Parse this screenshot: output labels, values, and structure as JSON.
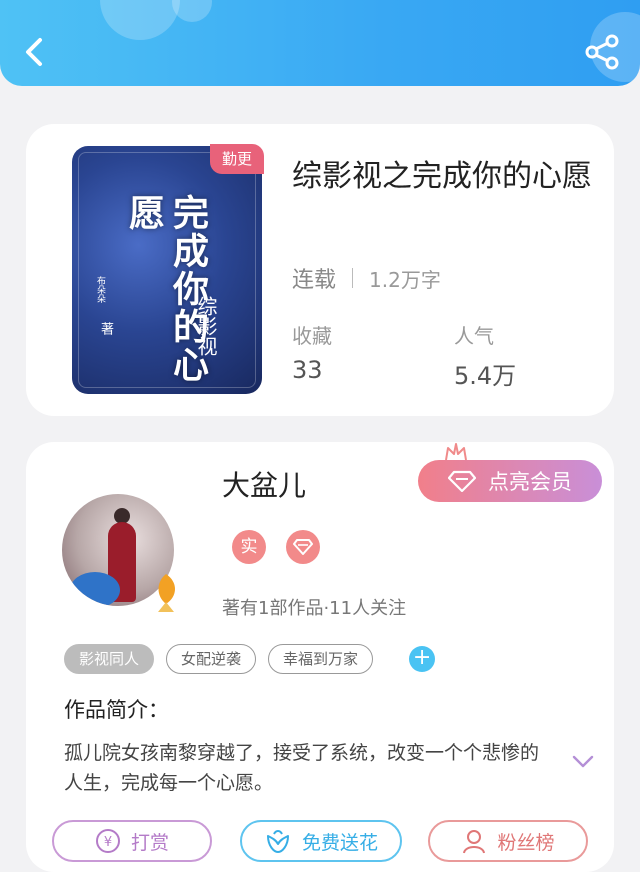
{
  "header": {
    "back_icon": "back-arrow-icon",
    "share_icon": "share-icon"
  },
  "book": {
    "badge": "勤更",
    "cover_title": "完成你的心愿",
    "cover_subtitle": "综影视",
    "cover_author": "布朵朵",
    "cover_author_mark": "著",
    "title": "综影视之完成你的心愿",
    "status": "连载",
    "word_count": "1.2万字",
    "stats": [
      {
        "label": "收藏",
        "value": "33"
      },
      {
        "label": "人气",
        "value": "5.4万"
      }
    ]
  },
  "author": {
    "name": "大盆儿",
    "vip_label": "点亮会员",
    "badges": [
      "实",
      "diamond"
    ],
    "info": "著有1部作品·11人关注",
    "tags": [
      "影视同人",
      "女配逆袭",
      "幸福到万家"
    ],
    "add_tag": "+",
    "intro_label": "作品简介：",
    "intro_text": "孤儿院女孩南黎穿越了，接受了系统，改变一个个悲惨的人生，完成每一个心愿。"
  },
  "actions": [
    {
      "label": "打赏",
      "icon": "yen-icon"
    },
    {
      "label": "免费送花",
      "icon": "flower-icon"
    },
    {
      "label": "粉丝榜",
      "icon": "user-icon"
    }
  ],
  "colors": {
    "accent": "#39a8f3",
    "badge": "#e8627a",
    "vip_start": "#f17f8a",
    "vip_end": "#c98fd8"
  }
}
